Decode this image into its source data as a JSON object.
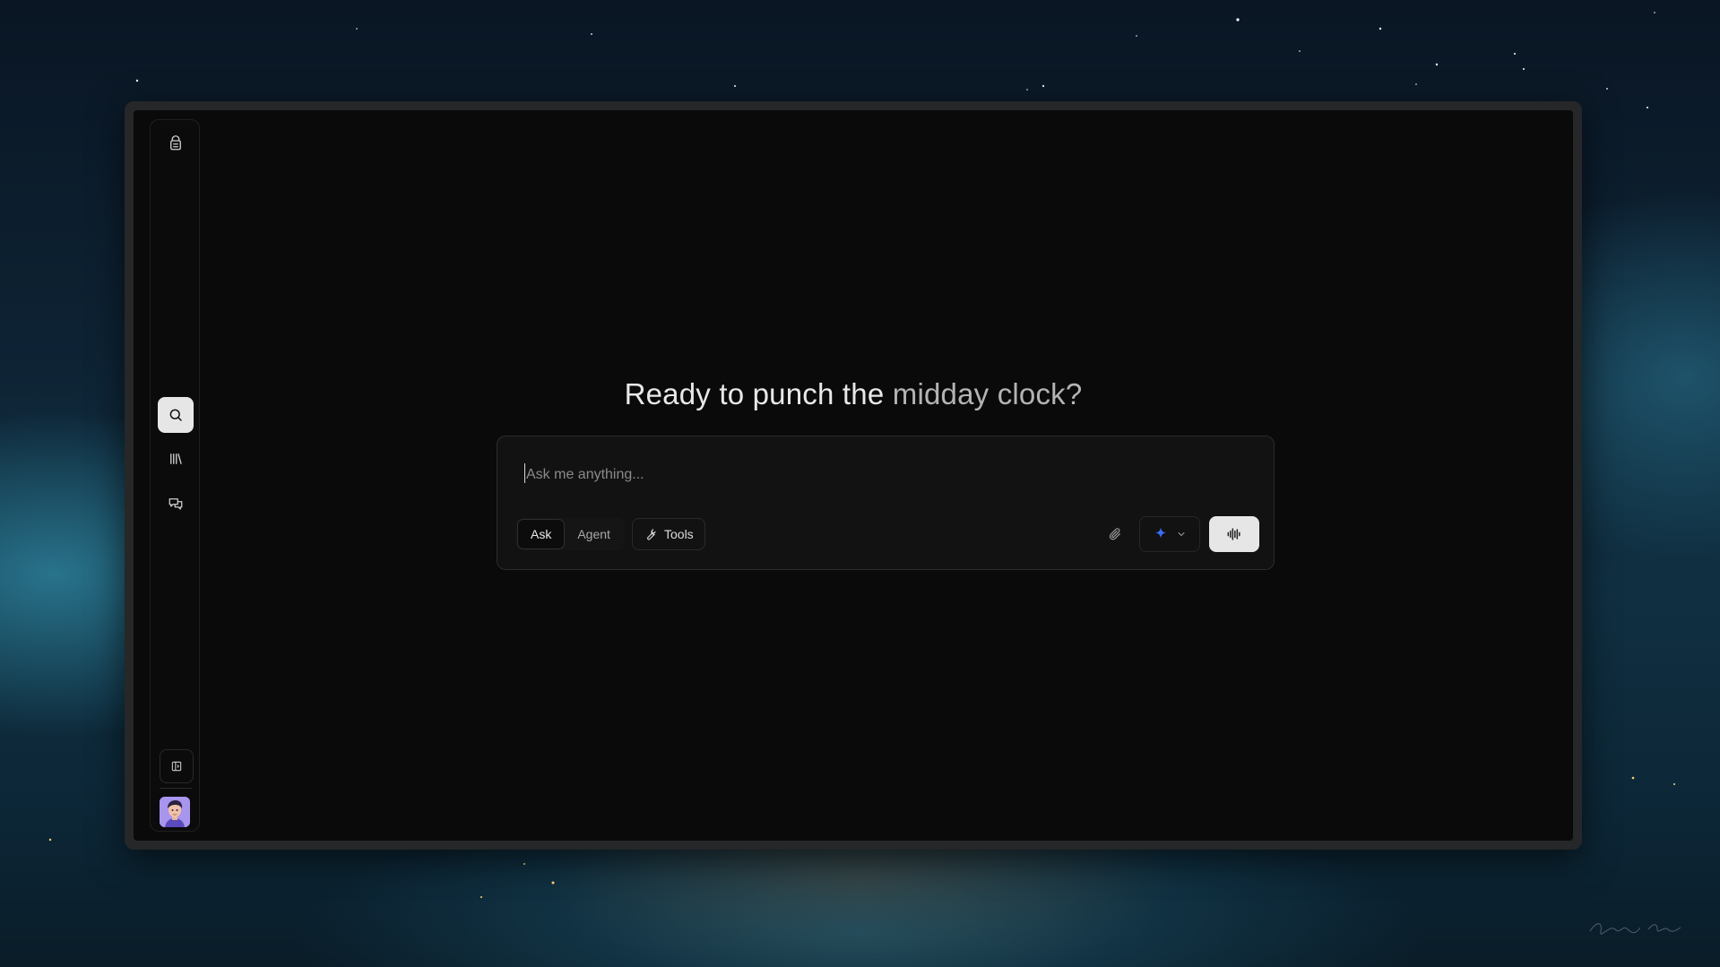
{
  "headline": {
    "main": "Ready to punch the",
    "accent": "midday clock?"
  },
  "composer": {
    "placeholder": "Ask me anything...",
    "modes": [
      {
        "label": "Ask",
        "active": true
      },
      {
        "label": "Agent",
        "active": false
      }
    ],
    "tools_label": "Tools"
  },
  "sidebar": {
    "items": [
      {
        "icon": "logo-icon"
      },
      {
        "icon": "search-icon",
        "active": true
      },
      {
        "icon": "library-icon"
      },
      {
        "icon": "chats-icon"
      },
      {
        "icon": "toggle-sidebar-icon"
      }
    ]
  },
  "colors": {
    "accent": "#3b6cf6",
    "panel": "#0a0a0a",
    "frame": "#252728"
  }
}
